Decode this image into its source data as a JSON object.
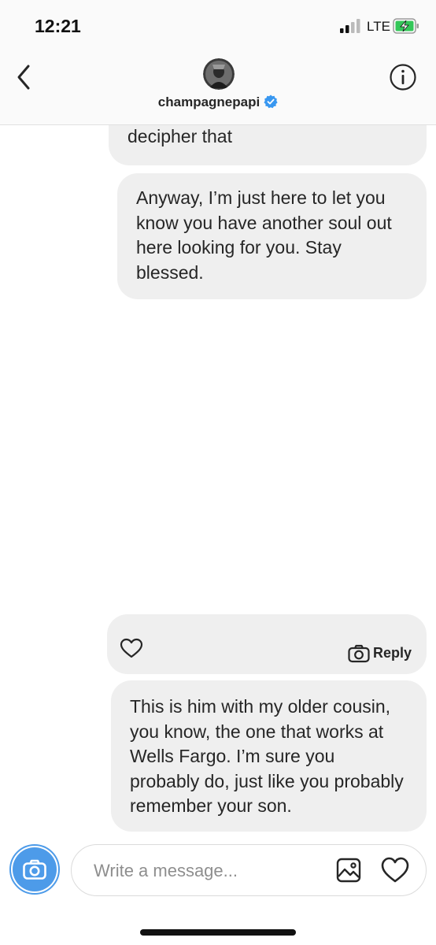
{
  "status_bar": {
    "time": "12:21",
    "network": "LTE",
    "icons": [
      "signal-icon",
      "battery-charging-icon"
    ]
  },
  "header": {
    "username": "champagnepapi",
    "verified": true,
    "icons": [
      "back-chevron-icon",
      "avatar",
      "verified-badge-icon",
      "info-icon"
    ]
  },
  "messages": [
    {
      "text": "decipher that"
    },
    {
      "text": "Anyway, I’m just here to let you know you have another soul out here looking for you. Stay blessed."
    },
    {
      "type": "story-reply",
      "reply_label": "Reply"
    },
    {
      "text": "This is him with my older cousin, you know, the one that works at Wells Fargo. I’m sure you probably do, just like you probably remember your son."
    }
  ],
  "composer": {
    "placeholder": "Write a message...",
    "icons": [
      "camera-icon",
      "gallery-icon",
      "heart-icon"
    ]
  },
  "colors": {
    "accent": "#4d9be9",
    "bubble": "#efefef",
    "text": "#262626",
    "placeholder": "#8e8e8e"
  }
}
